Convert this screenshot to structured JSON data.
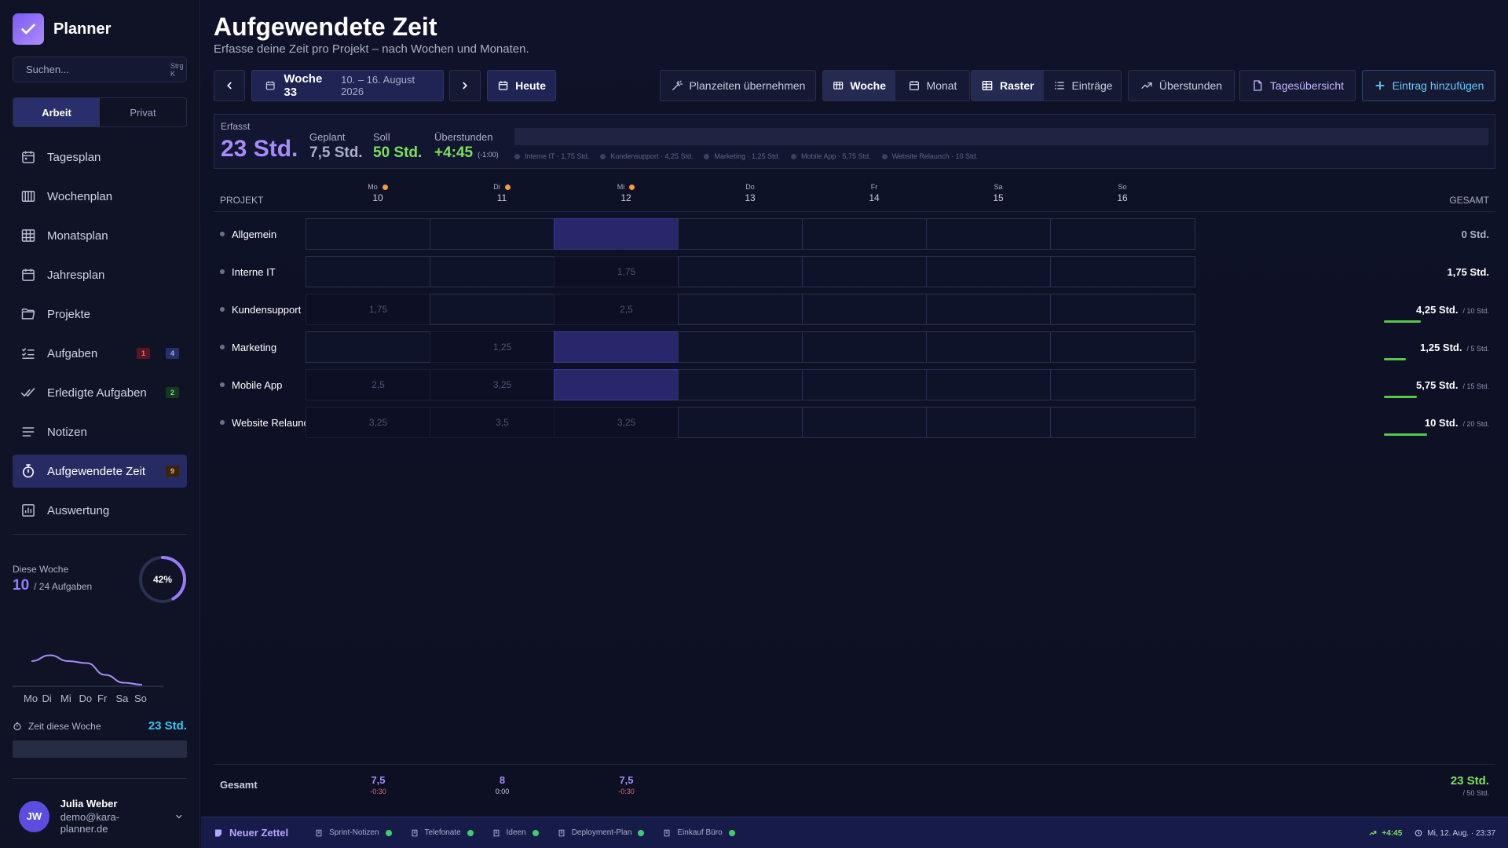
{
  "app": {
    "name": "Planner"
  },
  "search": {
    "placeholder": "Suchen...",
    "shortcut": "Strg K"
  },
  "workspace": {
    "options": [
      "Arbeit",
      "Privat"
    ],
    "active": "Arbeit"
  },
  "nav": [
    {
      "label": "Tagesplan",
      "icon": "calendar-day-icon"
    },
    {
      "label": "Wochenplan",
      "icon": "calendar-week-icon"
    },
    {
      "label": "Monatsplan",
      "icon": "grid-icon"
    },
    {
      "label": "Jahresplan",
      "icon": "calendar-icon"
    },
    {
      "label": "Projekte",
      "icon": "folder-icon"
    },
    {
      "label": "Aufgaben",
      "icon": "checklist-icon",
      "badges": [
        "1",
        "4"
      ]
    },
    {
      "label": "Erledigte Aufgaben",
      "icon": "double-check-icon",
      "badges": [
        "2"
      ]
    },
    {
      "label": "Notizen",
      "icon": "lines-icon"
    },
    {
      "label": "Aufgewendete Zeit",
      "icon": "stopwatch-icon",
      "badges": [
        "9"
      ],
      "active": true
    },
    {
      "label": "Auswertung",
      "icon": "chart-icon"
    }
  ],
  "week_stats": {
    "label": "Diese Woche",
    "done": "10",
    "total_text": "/ 24 Aufgaben",
    "percent_text": "42%",
    "percent": 0.42,
    "spark_days": [
      "Mo",
      "Di",
      "Mi",
      "Do",
      "Fr",
      "Sa",
      "So"
    ],
    "spark_values": [
      6,
      7.5,
      6,
      5.5,
      2.5,
      0.5,
      0
    ]
  },
  "time_week": {
    "label": "Zeit diese Woche",
    "value": "23 Std."
  },
  "user": {
    "initials": "JW",
    "name": "Julia Weber",
    "email": "demo@kara-planner.de"
  },
  "page": {
    "title": "Aufgewendete Zeit",
    "subtitle": "Erfasse deine Zeit pro Projekt – nach Wochen und Monaten."
  },
  "toolbar": {
    "week_label": "Woche 33",
    "week_range": "10. – 16. August 2026",
    "today": "Heute",
    "planzeiten": "Planzeiten übernehmen",
    "woche": "Woche",
    "monat": "Monat",
    "raster": "Raster",
    "eintraege": "Einträge",
    "ueberstunden": "Überstunden",
    "tagesuebersicht": "Tagesübersicht",
    "add_entry": "Eintrag hinzufügen"
  },
  "summary": {
    "erfasst_label": "Erfasst",
    "erfasst": "23 Std.",
    "geplant_label": "Geplant",
    "geplant": "7,5 Std.",
    "soll_label": "Soll",
    "soll": "50 Std.",
    "ueber_label": "Überstunden",
    "ueber": "+4:45",
    "ueber_note": "(-1:00)",
    "legend": [
      "Interne IT · 1,75 Std.",
      "Kundensupport · 4,25 Std.",
      "Marketing · 1,25 Std.",
      "Mobile App · 5,75 Std.",
      "Website Relaunch · 10 Std."
    ]
  },
  "grid": {
    "project_header": "PROJEKT",
    "total_header": "GESAMT",
    "days": [
      {
        "name": "Mo",
        "num": "10",
        "dot": true
      },
      {
        "name": "Di",
        "num": "11",
        "dot": true
      },
      {
        "name": "Mi",
        "num": "12",
        "dot": true
      },
      {
        "name": "Do",
        "num": "13",
        "dot": false
      },
      {
        "name": "Fr",
        "num": "14",
        "dot": false
      },
      {
        "name": "Sa",
        "num": "15",
        "dot": false
      },
      {
        "name": "So",
        "num": "16",
        "dot": false
      }
    ],
    "rows": [
      {
        "name": "Allgemein",
        "cells": [
          "",
          "",
          "",
          "",
          "",
          "",
          ""
        ],
        "selected": [
          2
        ],
        "total": "0 Std.",
        "goal": "",
        "progress": 0
      },
      {
        "name": "Interne IT",
        "cells": [
          "",
          "",
          "1,75",
          "",
          "",
          "",
          ""
        ],
        "selected": [],
        "total": "1,75 Std.",
        "goal": "",
        "progress": 0
      },
      {
        "name": "Kundensupport",
        "cells": [
          "1,75",
          "",
          "2,5",
          "",
          "",
          "",
          ""
        ],
        "selected": [],
        "total": "4,25 Std.",
        "goal": "/ 10 Std.",
        "progress": 0.425
      },
      {
        "name": "Marketing",
        "cells": [
          "",
          "1,25",
          "",
          "",
          "",
          "",
          ""
        ],
        "selected": [
          2
        ],
        "total": "1,25 Std.",
        "goal": "/ 5 Std.",
        "progress": 0.25
      },
      {
        "name": "Mobile App",
        "cells": [
          "2,5",
          "3,25",
          "",
          "",
          "",
          "",
          ""
        ],
        "selected": [
          2
        ],
        "total": "5,75 Std.",
        "goal": "/ 15 Std.",
        "progress": 0.383
      },
      {
        "name": "Website Relaunch",
        "cells": [
          "3,25",
          "3,5",
          "3,25",
          "",
          "",
          "",
          ""
        ],
        "selected": [],
        "total": "10 Std.",
        "goal": "/ 20 Std.",
        "progress": 0.5
      }
    ],
    "footer": {
      "label": "Gesamt",
      "days": [
        {
          "val": "7,5",
          "diff": "-0:30",
          "neg": true
        },
        {
          "val": "8",
          "diff": "0:00",
          "neg": false
        },
        {
          "val": "7,5",
          "diff": "-0:30",
          "neg": true
        }
      ],
      "total": "23 Std.",
      "goal": "/ 50 Std."
    }
  },
  "bottombar": {
    "new_note": "Neuer Zettel",
    "notes": [
      "Sprint-Notizen",
      "Telefonate",
      "Ideen",
      "Deployment-Plan",
      "Einkauf Büro"
    ],
    "overtime": "+4:45",
    "datetime": "Mi, 12. Aug. · 23:37"
  },
  "colors": {
    "accent": "#a78bfa",
    "green": "#7ce05c",
    "cyan": "#34c8f0",
    "active_nav": "#262b63",
    "selected_cell": "#28276b"
  }
}
